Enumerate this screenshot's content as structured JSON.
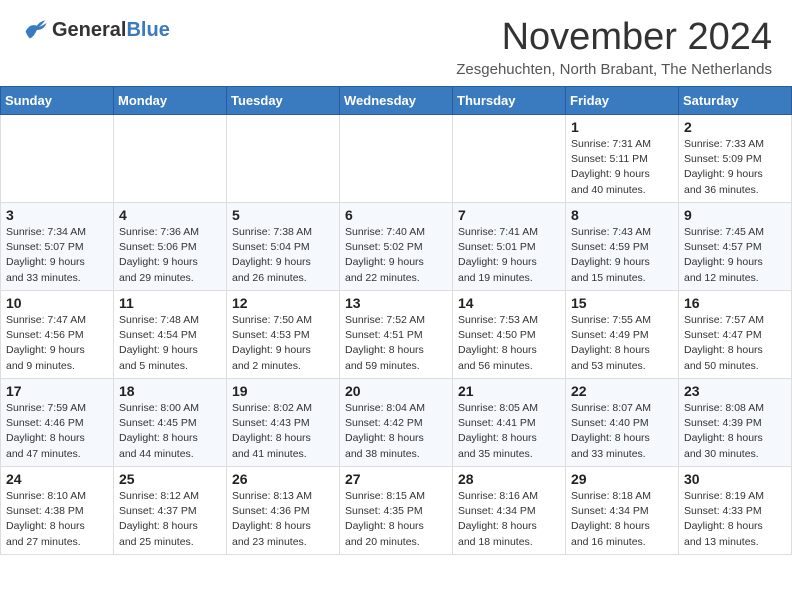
{
  "header": {
    "logo_general": "General",
    "logo_blue": "Blue",
    "month_title": "November 2024",
    "location": "Zesgehuchten, North Brabant, The Netherlands"
  },
  "days_of_week": [
    "Sunday",
    "Monday",
    "Tuesday",
    "Wednesday",
    "Thursday",
    "Friday",
    "Saturday"
  ],
  "weeks": [
    [
      {
        "day": "",
        "info": ""
      },
      {
        "day": "",
        "info": ""
      },
      {
        "day": "",
        "info": ""
      },
      {
        "day": "",
        "info": ""
      },
      {
        "day": "",
        "info": ""
      },
      {
        "day": "1",
        "info": "Sunrise: 7:31 AM\nSunset: 5:11 PM\nDaylight: 9 hours\nand 40 minutes."
      },
      {
        "day": "2",
        "info": "Sunrise: 7:33 AM\nSunset: 5:09 PM\nDaylight: 9 hours\nand 36 minutes."
      }
    ],
    [
      {
        "day": "3",
        "info": "Sunrise: 7:34 AM\nSunset: 5:07 PM\nDaylight: 9 hours\nand 33 minutes."
      },
      {
        "day": "4",
        "info": "Sunrise: 7:36 AM\nSunset: 5:06 PM\nDaylight: 9 hours\nand 29 minutes."
      },
      {
        "day": "5",
        "info": "Sunrise: 7:38 AM\nSunset: 5:04 PM\nDaylight: 9 hours\nand 26 minutes."
      },
      {
        "day": "6",
        "info": "Sunrise: 7:40 AM\nSunset: 5:02 PM\nDaylight: 9 hours\nand 22 minutes."
      },
      {
        "day": "7",
        "info": "Sunrise: 7:41 AM\nSunset: 5:01 PM\nDaylight: 9 hours\nand 19 minutes."
      },
      {
        "day": "8",
        "info": "Sunrise: 7:43 AM\nSunset: 4:59 PM\nDaylight: 9 hours\nand 15 minutes."
      },
      {
        "day": "9",
        "info": "Sunrise: 7:45 AM\nSunset: 4:57 PM\nDaylight: 9 hours\nand 12 minutes."
      }
    ],
    [
      {
        "day": "10",
        "info": "Sunrise: 7:47 AM\nSunset: 4:56 PM\nDaylight: 9 hours\nand 9 minutes."
      },
      {
        "day": "11",
        "info": "Sunrise: 7:48 AM\nSunset: 4:54 PM\nDaylight: 9 hours\nand 5 minutes."
      },
      {
        "day": "12",
        "info": "Sunrise: 7:50 AM\nSunset: 4:53 PM\nDaylight: 9 hours\nand 2 minutes."
      },
      {
        "day": "13",
        "info": "Sunrise: 7:52 AM\nSunset: 4:51 PM\nDaylight: 8 hours\nand 59 minutes."
      },
      {
        "day": "14",
        "info": "Sunrise: 7:53 AM\nSunset: 4:50 PM\nDaylight: 8 hours\nand 56 minutes."
      },
      {
        "day": "15",
        "info": "Sunrise: 7:55 AM\nSunset: 4:49 PM\nDaylight: 8 hours\nand 53 minutes."
      },
      {
        "day": "16",
        "info": "Sunrise: 7:57 AM\nSunset: 4:47 PM\nDaylight: 8 hours\nand 50 minutes."
      }
    ],
    [
      {
        "day": "17",
        "info": "Sunrise: 7:59 AM\nSunset: 4:46 PM\nDaylight: 8 hours\nand 47 minutes."
      },
      {
        "day": "18",
        "info": "Sunrise: 8:00 AM\nSunset: 4:45 PM\nDaylight: 8 hours\nand 44 minutes."
      },
      {
        "day": "19",
        "info": "Sunrise: 8:02 AM\nSunset: 4:43 PM\nDaylight: 8 hours\nand 41 minutes."
      },
      {
        "day": "20",
        "info": "Sunrise: 8:04 AM\nSunset: 4:42 PM\nDaylight: 8 hours\nand 38 minutes."
      },
      {
        "day": "21",
        "info": "Sunrise: 8:05 AM\nSunset: 4:41 PM\nDaylight: 8 hours\nand 35 minutes."
      },
      {
        "day": "22",
        "info": "Sunrise: 8:07 AM\nSunset: 4:40 PM\nDaylight: 8 hours\nand 33 minutes."
      },
      {
        "day": "23",
        "info": "Sunrise: 8:08 AM\nSunset: 4:39 PM\nDaylight: 8 hours\nand 30 minutes."
      }
    ],
    [
      {
        "day": "24",
        "info": "Sunrise: 8:10 AM\nSunset: 4:38 PM\nDaylight: 8 hours\nand 27 minutes."
      },
      {
        "day": "25",
        "info": "Sunrise: 8:12 AM\nSunset: 4:37 PM\nDaylight: 8 hours\nand 25 minutes."
      },
      {
        "day": "26",
        "info": "Sunrise: 8:13 AM\nSunset: 4:36 PM\nDaylight: 8 hours\nand 23 minutes."
      },
      {
        "day": "27",
        "info": "Sunrise: 8:15 AM\nSunset: 4:35 PM\nDaylight: 8 hours\nand 20 minutes."
      },
      {
        "day": "28",
        "info": "Sunrise: 8:16 AM\nSunset: 4:34 PM\nDaylight: 8 hours\nand 18 minutes."
      },
      {
        "day": "29",
        "info": "Sunrise: 8:18 AM\nSunset: 4:34 PM\nDaylight: 8 hours\nand 16 minutes."
      },
      {
        "day": "30",
        "info": "Sunrise: 8:19 AM\nSunset: 4:33 PM\nDaylight: 8 hours\nand 13 minutes."
      }
    ]
  ]
}
